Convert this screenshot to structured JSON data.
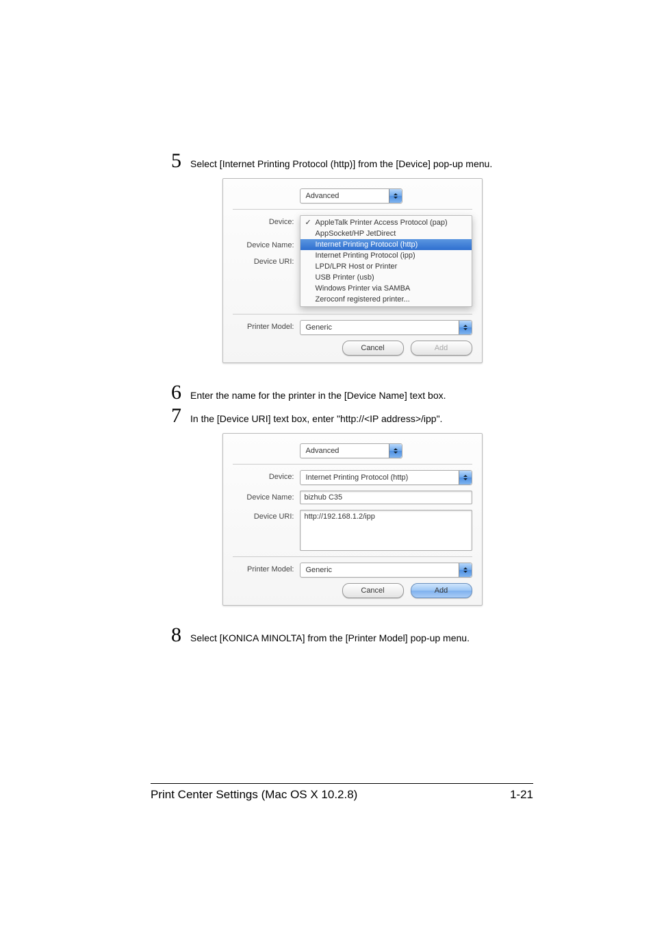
{
  "steps": {
    "s5": {
      "num": "5",
      "text": "Select [Internet Printing Protocol (http)] from the [Device] pop-up menu."
    },
    "s6": {
      "num": "6",
      "text": "Enter the name for the printer in the [Device Name] text box."
    },
    "s7": {
      "num": "7",
      "text": "In the [Device URI] text box, enter \"http://<IP address>/ipp\"."
    },
    "s8": {
      "num": "8",
      "text": "Select [KONICA MINOLTA] from the [Printer Model] pop-up menu."
    }
  },
  "shot1": {
    "top_select": "Advanced",
    "labels": {
      "device": "Device:",
      "name": "Device Name:",
      "uri": "Device URI:",
      "model": "Printer Model:"
    },
    "menu": {
      "i0": "AppleTalk Printer Access Protocol (pap)",
      "i1": "AppSocket/HP JetDirect",
      "i2": "Internet Printing Protocol (http)",
      "i3": "Internet Printing Protocol (ipp)",
      "i4": "LPD/LPR Host or Printer",
      "i5": "USB Printer (usb)",
      "i6": "Windows Printer via SAMBA",
      "i7": "Zeroconf registered printer..."
    },
    "model_value": "Generic",
    "buttons": {
      "cancel": "Cancel",
      "add": "Add"
    }
  },
  "shot2": {
    "top_select": "Advanced",
    "labels": {
      "device": "Device:",
      "name": "Device Name:",
      "uri": "Device URI:",
      "model": "Printer Model:"
    },
    "device_value": "Internet Printing Protocol (http)",
    "name_value": "bizhub C35",
    "uri_value": "http://192.168.1.2/ipp",
    "model_value": "Generic",
    "buttons": {
      "cancel": "Cancel",
      "add": "Add"
    }
  },
  "footer": {
    "left": "Print Center Settings (Mac OS X 10.2.8)",
    "right": "1-21"
  }
}
